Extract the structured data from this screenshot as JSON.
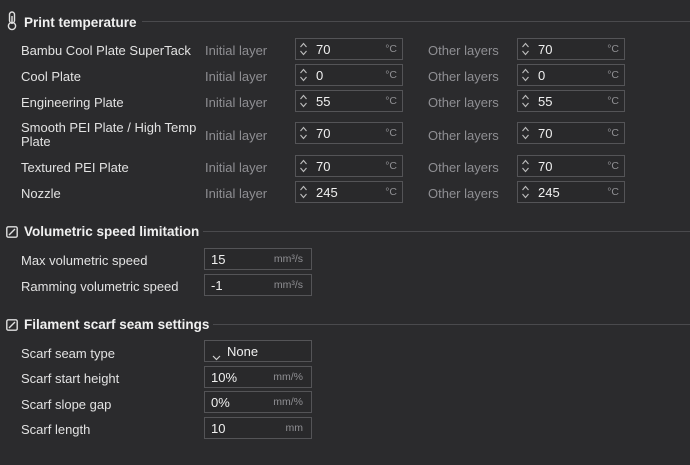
{
  "sections": {
    "print_temp": {
      "title": "Print temperature"
    },
    "volumetric": {
      "title": "Volumetric speed limitation"
    },
    "scarf": {
      "title": "Filament scarf seam settings"
    }
  },
  "temperature": {
    "initial_label": "Initial layer",
    "other_label": "Other layers",
    "unit": "°C",
    "rows": [
      {
        "label": "Bambu Cool Plate SuperTack",
        "initial": "70",
        "other": "70"
      },
      {
        "label": "Cool Plate",
        "initial": "0",
        "other": "0"
      },
      {
        "label": "Engineering Plate",
        "initial": "55",
        "other": "55"
      },
      {
        "label": "Smooth PEI Plate / High Temp Plate",
        "initial": "70",
        "other": "70"
      },
      {
        "label": "Textured PEI Plate",
        "initial": "70",
        "other": "70"
      },
      {
        "label": "Nozzle",
        "initial": "245",
        "other": "245"
      }
    ]
  },
  "volumetric_fields": [
    {
      "label": "Max volumetric speed",
      "value": "15",
      "unit": "mm³/s"
    },
    {
      "label": "Ramming volumetric speed",
      "value": "-1",
      "unit": "mm³/s"
    }
  ],
  "scarf_fields": {
    "seam_type": {
      "label": "Scarf seam type",
      "value": "None"
    },
    "start_height": {
      "label": "Scarf start height",
      "value": "10%",
      "unit": "mm/%"
    },
    "slope_gap": {
      "label": "Scarf slope gap",
      "value": "0%",
      "unit": "mm/%"
    },
    "length": {
      "label": "Scarf length",
      "value": "10",
      "unit": "mm"
    }
  },
  "icons": {
    "temperature": "thermometer-icon",
    "section_toggle": "edit-square-icon",
    "dropdown": "chevron-down-icon",
    "spinner": "up-down-arrows-icon"
  }
}
